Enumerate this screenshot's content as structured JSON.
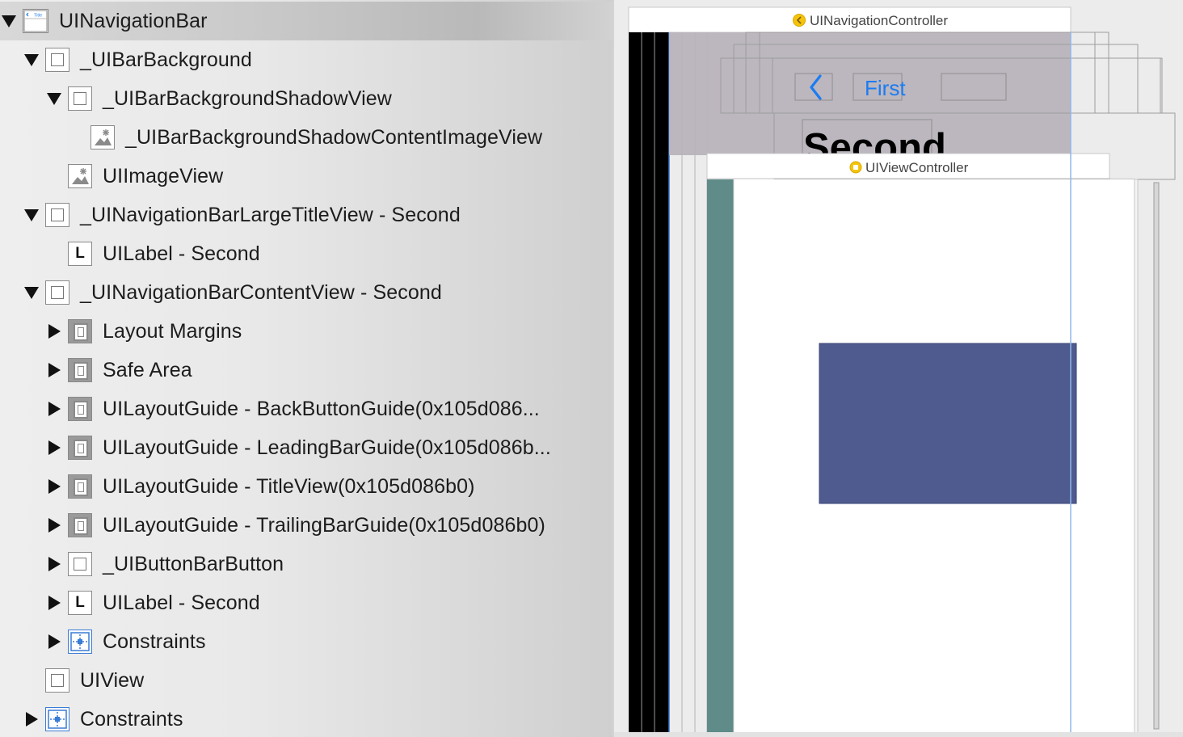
{
  "outline": {
    "rows": [
      {
        "label": "UINavigationBar",
        "disclosure": "expanded",
        "icon": "navbar-icon",
        "icon_text": "Title",
        "selected": true
      },
      {
        "label": "_UIBarBackground",
        "disclosure": "expanded",
        "icon": "view-icon"
      },
      {
        "label": "_UIBarBackgroundShadowView",
        "disclosure": "expanded",
        "icon": "view-icon"
      },
      {
        "label": "_UIBarBackgroundShadowContentImageView",
        "disclosure": "none",
        "icon": "image-view-icon"
      },
      {
        "label": "UIImageView",
        "disclosure": "none",
        "icon": "image-view-icon"
      },
      {
        "label": "_UINavigationBarLargeTitleView - Second",
        "disclosure": "expanded",
        "icon": "view-icon"
      },
      {
        "label": "UILabel - Second",
        "disclosure": "none",
        "icon": "label-icon",
        "icon_text": "L"
      },
      {
        "label": "_UINavigationBarContentView - Second",
        "disclosure": "expanded",
        "icon": "view-icon"
      },
      {
        "label": "Layout Margins",
        "disclosure": "collapsed",
        "icon": "layout-guide-icon"
      },
      {
        "label": "Safe Area",
        "disclosure": "collapsed",
        "icon": "layout-guide-icon"
      },
      {
        "label": "UILayoutGuide - BackButtonGuide(0x105d086...",
        "disclosure": "collapsed",
        "icon": "layout-guide-icon"
      },
      {
        "label": "UILayoutGuide - LeadingBarGuide(0x105d086b...",
        "disclosure": "collapsed",
        "icon": "layout-guide-icon"
      },
      {
        "label": "UILayoutGuide - TitleView(0x105d086b0)",
        "disclosure": "collapsed",
        "icon": "layout-guide-icon"
      },
      {
        "label": "UILayoutGuide - TrailingBarGuide(0x105d086b0)",
        "disclosure": "collapsed",
        "icon": "layout-guide-icon"
      },
      {
        "label": "_UIButtonBarButton",
        "disclosure": "collapsed",
        "icon": "view-icon"
      },
      {
        "label": "UILabel - Second",
        "disclosure": "collapsed",
        "icon": "label-icon",
        "icon_text": "L"
      },
      {
        "label": "Constraints",
        "disclosure": "collapsed",
        "icon": "constraints-icon"
      },
      {
        "label": "UIView",
        "disclosure": "none",
        "icon": "view-icon"
      },
      {
        "label": "Constraints",
        "disclosure": "collapsed",
        "icon": "constraints-icon"
      }
    ]
  },
  "canvas": {
    "nav_controller_label": "UINavigationController",
    "view_controller_label": "UIViewController",
    "back_button_label": "First",
    "large_title": "Second",
    "back_chevron_icon": "chevron-left-icon",
    "controller_badge_icon": "controller-badge-icon",
    "colors": {
      "overlay": "#b9b3bc",
      "accent_blue": "#1a7cf2",
      "teal_strip": "#5f8b89",
      "content_block": "#4f5b8f",
      "badge_yellow": "#f5c40a"
    }
  }
}
